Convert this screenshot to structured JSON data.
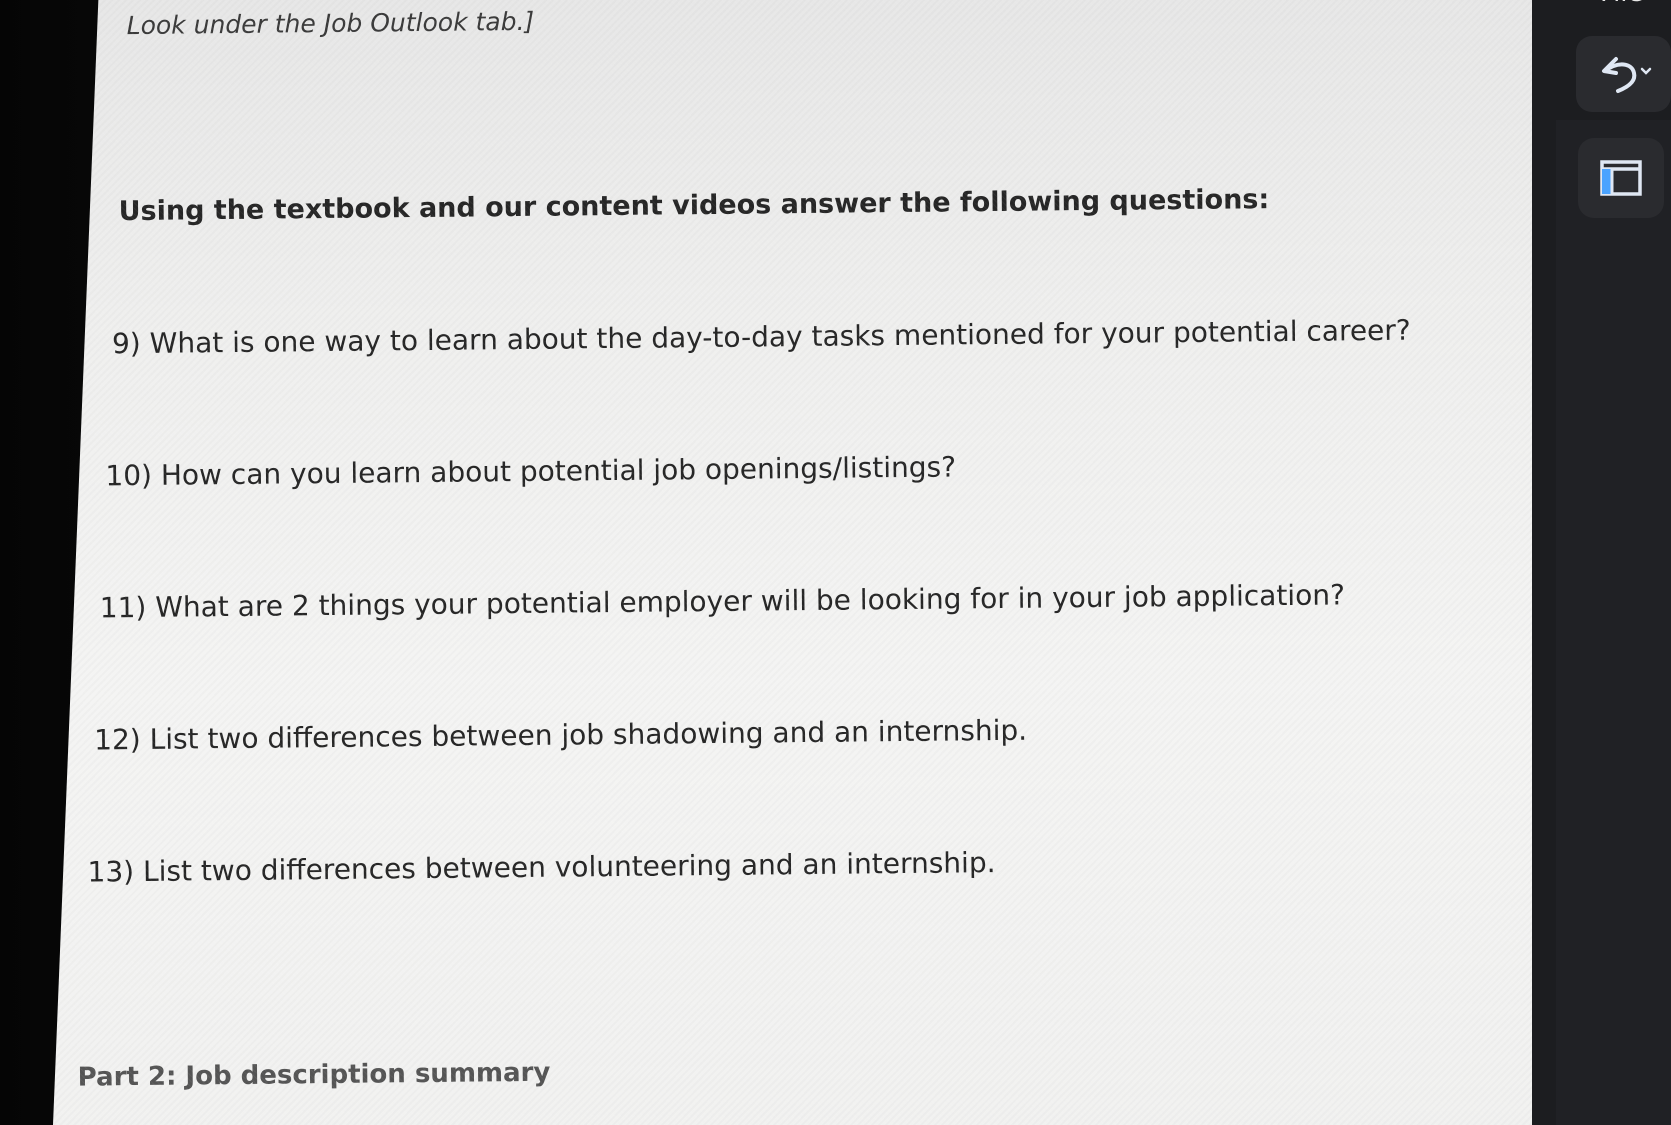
{
  "document": {
    "note": "Look under the Job Outlook tab.]",
    "heading": "Using the textbook and our content videos answer the following questions:",
    "questions": [
      "9)  What is one way to learn about the day-to-day tasks mentioned for your potential career?",
      "10) How can you learn about potential job openings/listings?",
      "11) What are 2 things your potential employer will be looking for in your job application?",
      "12) List two differences between job shadowing and an internship.",
      "13) List two differences between volunteering and an internship."
    ],
    "part_heading": "Part 2: Job description summary"
  },
  "toolbar": {
    "file_label": "File",
    "undo_icon": "undo-icon",
    "layout_icon": "panel-layout-icon"
  },
  "colors": {
    "paper": "#efefee",
    "text": "#262626",
    "panel": "#1c1d20",
    "icon": "#dfe7f3"
  }
}
